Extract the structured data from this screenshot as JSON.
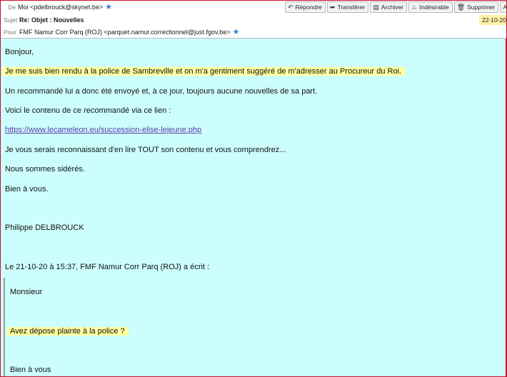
{
  "header": {
    "from_label": "De",
    "from_value": "Moi <pdelbrouck@skynet.be>",
    "subject_label": "Sujet",
    "subject_value": "Re: Objet : Nouvelles",
    "to_label": "Pour",
    "to_value": "FMF Namur Corr Parq (ROJ) <parquet.namur.correctionnel@just.fgov.be>",
    "date": "22-10-20",
    "star_icon": "star-icon"
  },
  "toolbar": {
    "reply": "Répondre",
    "forward": "Transférer",
    "archive": "Archiver",
    "junk": "Indésirable",
    "delete": "Supprimer",
    "more": "A"
  },
  "body": {
    "greeting": "Bonjour,",
    "p1": "Je me suis bien rendu à la police de Sambreville et on m'a gentiment suggéré de m'adresser au Procureur du Roi.",
    "p2": "Un recommandé lui a donc été envoyé et, à ce jour, toujours aucune nouvelles de sa part.",
    "p3": "Voici le contenu de ce recommandé via ce lien :",
    "link": "https://www.lecameleon.eu/succession-elise-lejeune.php",
    "p4": "Je vous serais reconnaissant d'en lire TOUT son contenu et vous comprendrez...",
    "p5": "Nous sommes sidérés.",
    "p6": "Bien à vous.",
    "signature": "Philippe DELBROUCK",
    "quote_intro": "Le 21-10-20 à 15:37, FMF Namur Corr Parq (ROJ) a écrit :",
    "q1": "Monsieur",
    "q2": "Avez dépose plainte à la police ?",
    "q3": "Bien à vous"
  },
  "colors": {
    "body_bg": "#cdfefe",
    "highlight": "#ffff9e",
    "date_bg": "#fff2a8",
    "link": "#5b3aa8",
    "frame": "#c8102e"
  }
}
